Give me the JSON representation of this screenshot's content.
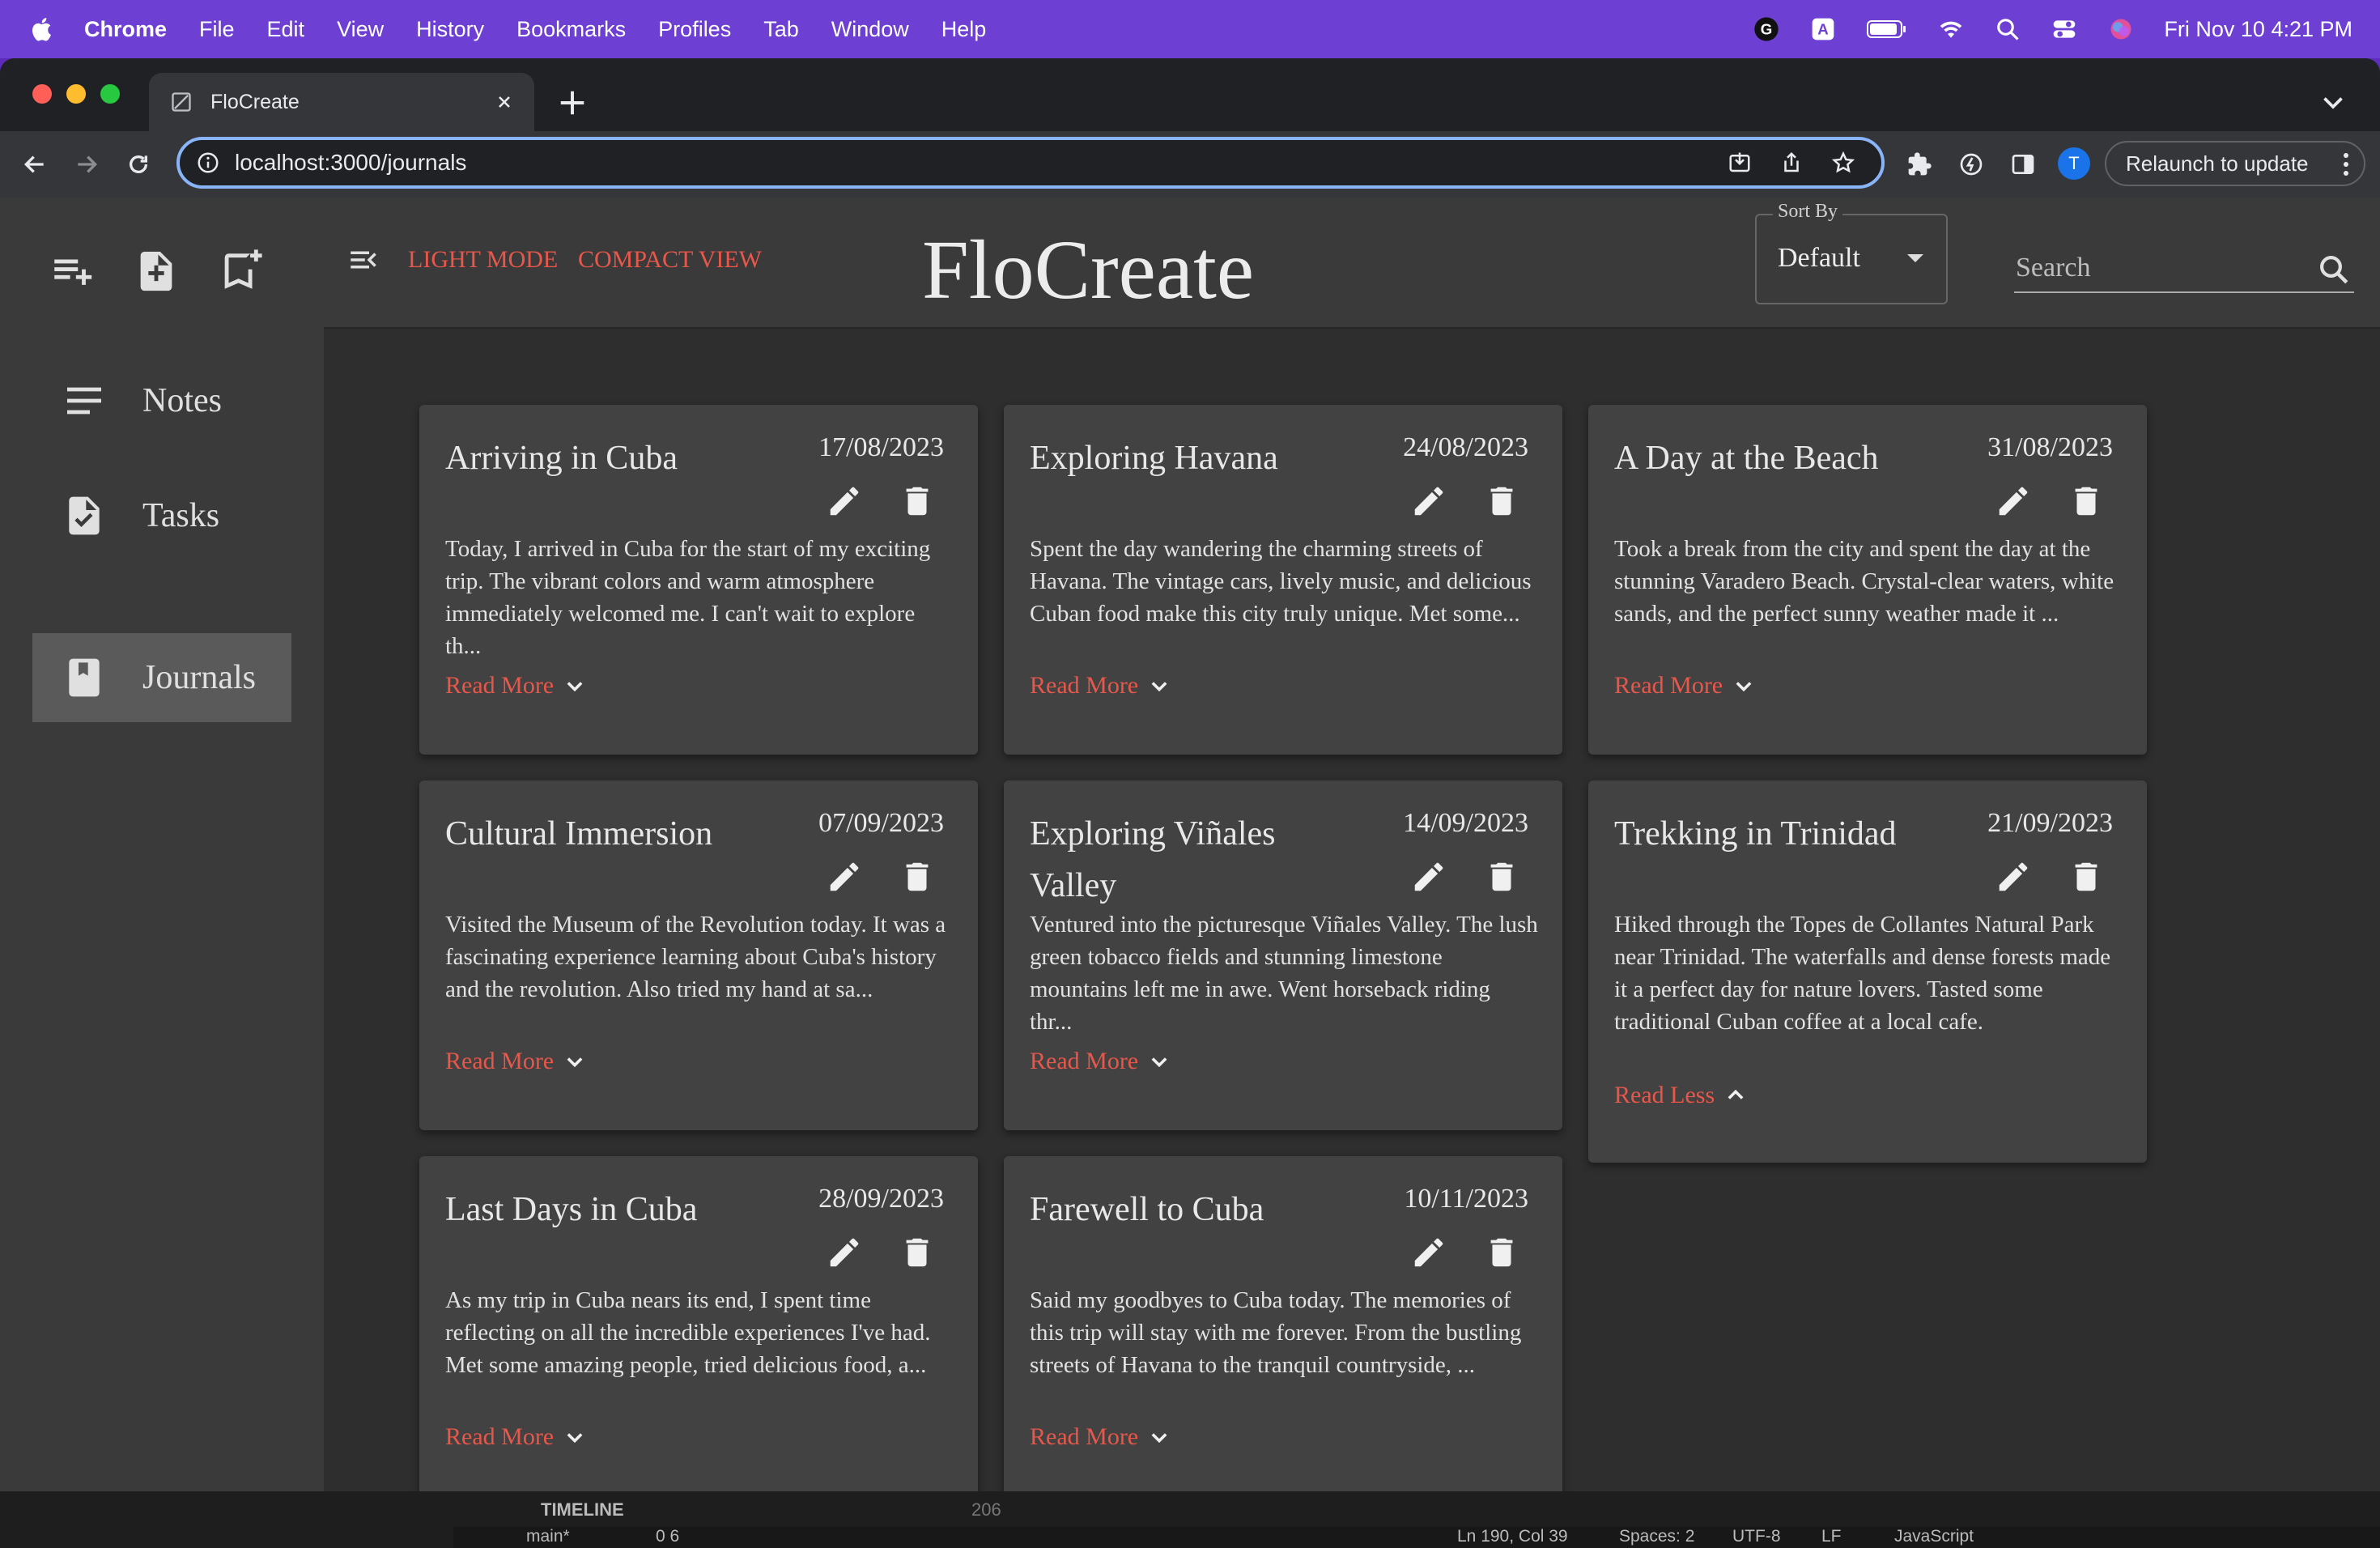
{
  "macos_menubar": {
    "app": "Chrome",
    "menus": [
      "File",
      "Edit",
      "View",
      "History",
      "Bookmarks",
      "Profiles",
      "Tab",
      "Window",
      "Help"
    ],
    "clock": "Fri Nov 10  4:21 PM"
  },
  "browser": {
    "tab_title": "FloCreate",
    "url": "localhost:3000/journals",
    "relaunch_label": "Relaunch to update",
    "profile_initial": "T"
  },
  "sidebar": {
    "items": [
      {
        "label": "Notes"
      },
      {
        "label": "Tasks"
      },
      {
        "label": "Journals"
      }
    ]
  },
  "appbar": {
    "light_mode": "LIGHT MODE",
    "compact_view": "COMPACT VIEW",
    "brand": "FloCreate",
    "sort_legend": "Sort By",
    "sort_value": "Default",
    "search_placeholder": "Search"
  },
  "journals": [
    {
      "title": "Arriving in Cuba",
      "date": "17/08/2023",
      "body": "Today, I arrived in Cuba for the start of my exciting trip. The vibrant colors and warm atmosphere immediately welcomed me. I can't wait to explore th...",
      "toggle": "Read More"
    },
    {
      "title": "Exploring Havana",
      "date": "24/08/2023",
      "body": "Spent the day wandering the charming streets of Havana. The vintage cars, lively music, and delicious Cuban food make this city truly unique. Met some...",
      "toggle": "Read More"
    },
    {
      "title": "A Day at the Beach",
      "date": "31/08/2023",
      "body": "Took a break from the city and spent the day at the stunning Varadero Beach. Crystal-clear waters, white sands, and the perfect sunny weather made it ...",
      "toggle": "Read More"
    },
    {
      "title": "Cultural Immersion",
      "date": "07/09/2023",
      "body": "Visited the Museum of the Revolution today. It was a fascinating experience learning about Cuba's history and the revolution. Also tried my hand at sa...",
      "toggle": "Read More"
    },
    {
      "title": "Exploring Viñales Valley",
      "date": "14/09/2023",
      "body": "Ventured into the picturesque Viñales Valley. The lush green tobacco fields and stunning limestone mountains left me in awe. Went horseback riding thr...",
      "toggle": "Read More"
    },
    {
      "title": "Trekking in Trinidad",
      "date": "21/09/2023",
      "body": "Hiked through the Topes de Collantes Natural Park near Trinidad. The waterfalls and dense forests made it a perfect day for nature lovers. Tasted some traditional Cuban coffee at a local cafe.",
      "toggle": "Read Less"
    },
    {
      "title": "Last Days in Cuba",
      "date": "28/09/2023",
      "body": "As my trip in Cuba nears its end, I spent time reflecting on all the incredible experiences I've had. Met some amazing people, tried delicious food, a...",
      "toggle": "Read More"
    },
    {
      "title": "Farewell to Cuba",
      "date": "10/11/2023",
      "body": "Said my goodbyes to Cuba today. The memories of this trip will stay with me forever. From the bustling streets of Havana to the tranquil countryside, ...",
      "toggle": "Read More"
    }
  ],
  "vscode": {
    "panel_label": "TIMELINE",
    "line_number": "206",
    "branch": "main*",
    "problems": "0  6",
    "cursor": "Ln 190, Col 39",
    "spaces": "Spaces: 2",
    "encoding": "UTF-8",
    "eol": "LF",
    "language": "JavaScript"
  },
  "colors": {
    "accent_link": "#e8574a",
    "card_bg": "#424242",
    "content_bg": "#2e2e2e",
    "menubar_purple": "#6e3fd3"
  }
}
